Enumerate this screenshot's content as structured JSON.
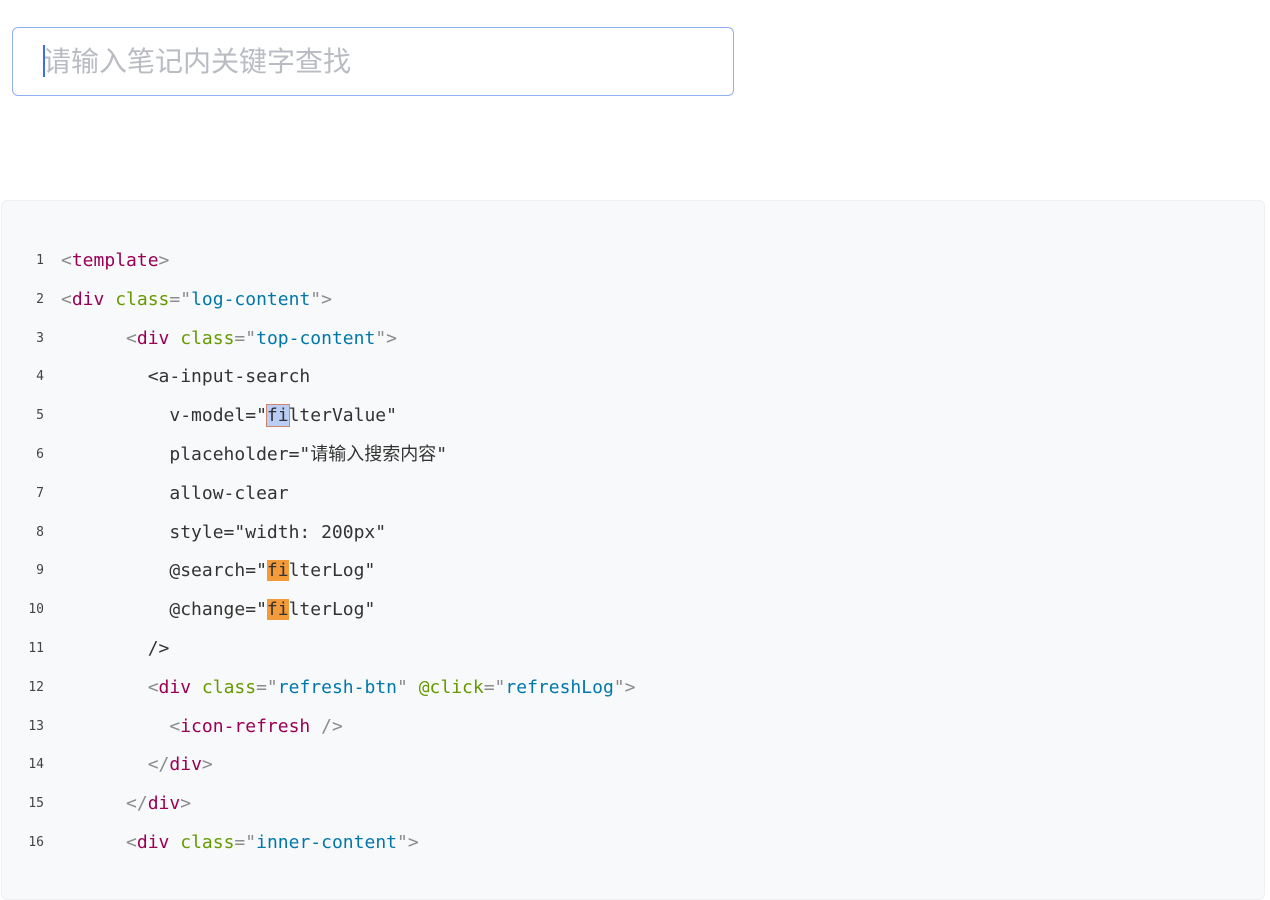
{
  "search": {
    "placeholder": "请输入笔记内关键字查找",
    "value": ""
  },
  "code": {
    "lines": [
      {
        "n": "1",
        "tokens": [
          {
            "t": "<",
            "c": "punc"
          },
          {
            "t": "template",
            "c": "tag"
          },
          {
            "t": ">",
            "c": "punc"
          }
        ]
      },
      {
        "n": "2",
        "tokens": [
          {
            "t": "<",
            "c": "punc"
          },
          {
            "t": "div",
            "c": "tag"
          },
          {
            "t": " ",
            "c": "plain"
          },
          {
            "t": "class",
            "c": "attr"
          },
          {
            "t": "=\"",
            "c": "punc"
          },
          {
            "t": "log-content",
            "c": "str"
          },
          {
            "t": "\">",
            "c": "punc"
          }
        ]
      },
      {
        "n": "3",
        "tokens": [
          {
            "t": "      ",
            "c": "plain"
          },
          {
            "t": "<",
            "c": "punc"
          },
          {
            "t": "div",
            "c": "tag"
          },
          {
            "t": " ",
            "c": "plain"
          },
          {
            "t": "class",
            "c": "attr"
          },
          {
            "t": "=\"",
            "c": "punc"
          },
          {
            "t": "top-content",
            "c": "str"
          },
          {
            "t": "\">",
            "c": "punc"
          }
        ]
      },
      {
        "n": "4",
        "tokens": [
          {
            "t": "        <a-input-search",
            "c": "plain"
          }
        ]
      },
      {
        "n": "5",
        "tokens": [
          {
            "t": "          v-model=\"",
            "c": "plain"
          },
          {
            "t": "fi",
            "c": "hl-cur"
          },
          {
            "t": "lterValue\"",
            "c": "plain"
          }
        ]
      },
      {
        "n": "6",
        "tokens": [
          {
            "t": "          placeholder=\"请输入搜索内容\"",
            "c": "plain"
          }
        ]
      },
      {
        "n": "7",
        "tokens": [
          {
            "t": "          allow-clear",
            "c": "plain"
          }
        ]
      },
      {
        "n": "8",
        "tokens": [
          {
            "t": "          style=\"width: 200px\"",
            "c": "plain"
          }
        ]
      },
      {
        "n": "9",
        "tokens": [
          {
            "t": "          @search=\"",
            "c": "plain"
          },
          {
            "t": "fi",
            "c": "hl-match"
          },
          {
            "t": "lterLog\"",
            "c": "plain"
          }
        ]
      },
      {
        "n": "10",
        "tokens": [
          {
            "t": "          @change=\"",
            "c": "plain"
          },
          {
            "t": "fi",
            "c": "hl-match"
          },
          {
            "t": "lterLog\"",
            "c": "plain"
          }
        ]
      },
      {
        "n": "11",
        "tokens": [
          {
            "t": "        />",
            "c": "plain"
          }
        ]
      },
      {
        "n": "12",
        "tokens": [
          {
            "t": "        ",
            "c": "plain"
          },
          {
            "t": "<",
            "c": "punc"
          },
          {
            "t": "div",
            "c": "tag"
          },
          {
            "t": " ",
            "c": "plain"
          },
          {
            "t": "class",
            "c": "attr"
          },
          {
            "t": "=\"",
            "c": "punc"
          },
          {
            "t": "refresh-btn",
            "c": "str"
          },
          {
            "t": "\" ",
            "c": "punc"
          },
          {
            "t": "@click",
            "c": "attr"
          },
          {
            "t": "=\"",
            "c": "punc"
          },
          {
            "t": "refreshLog",
            "c": "str"
          },
          {
            "t": "\">",
            "c": "punc"
          }
        ]
      },
      {
        "n": "13",
        "tokens": [
          {
            "t": "          ",
            "c": "plain"
          },
          {
            "t": "<",
            "c": "punc"
          },
          {
            "t": "icon-refresh",
            "c": "tag"
          },
          {
            "t": " />",
            "c": "punc"
          }
        ]
      },
      {
        "n": "14",
        "tokens": [
          {
            "t": "        ",
            "c": "plain"
          },
          {
            "t": "</",
            "c": "punc"
          },
          {
            "t": "div",
            "c": "tag"
          },
          {
            "t": ">",
            "c": "punc"
          }
        ]
      },
      {
        "n": "15",
        "tokens": [
          {
            "t": "      ",
            "c": "plain"
          },
          {
            "t": "</",
            "c": "punc"
          },
          {
            "t": "div",
            "c": "tag"
          },
          {
            "t": ">",
            "c": "punc"
          }
        ]
      },
      {
        "n": "16",
        "tokens": [
          {
            "t": "      ",
            "c": "plain"
          },
          {
            "t": "<",
            "c": "punc"
          },
          {
            "t": "div",
            "c": "tag"
          },
          {
            "t": " ",
            "c": "plain"
          },
          {
            "t": "class",
            "c": "attr"
          },
          {
            "t": "=\"",
            "c": "punc"
          },
          {
            "t": "inner-content",
            "c": "str"
          },
          {
            "t": "\">",
            "c": "punc"
          }
        ]
      }
    ]
  }
}
